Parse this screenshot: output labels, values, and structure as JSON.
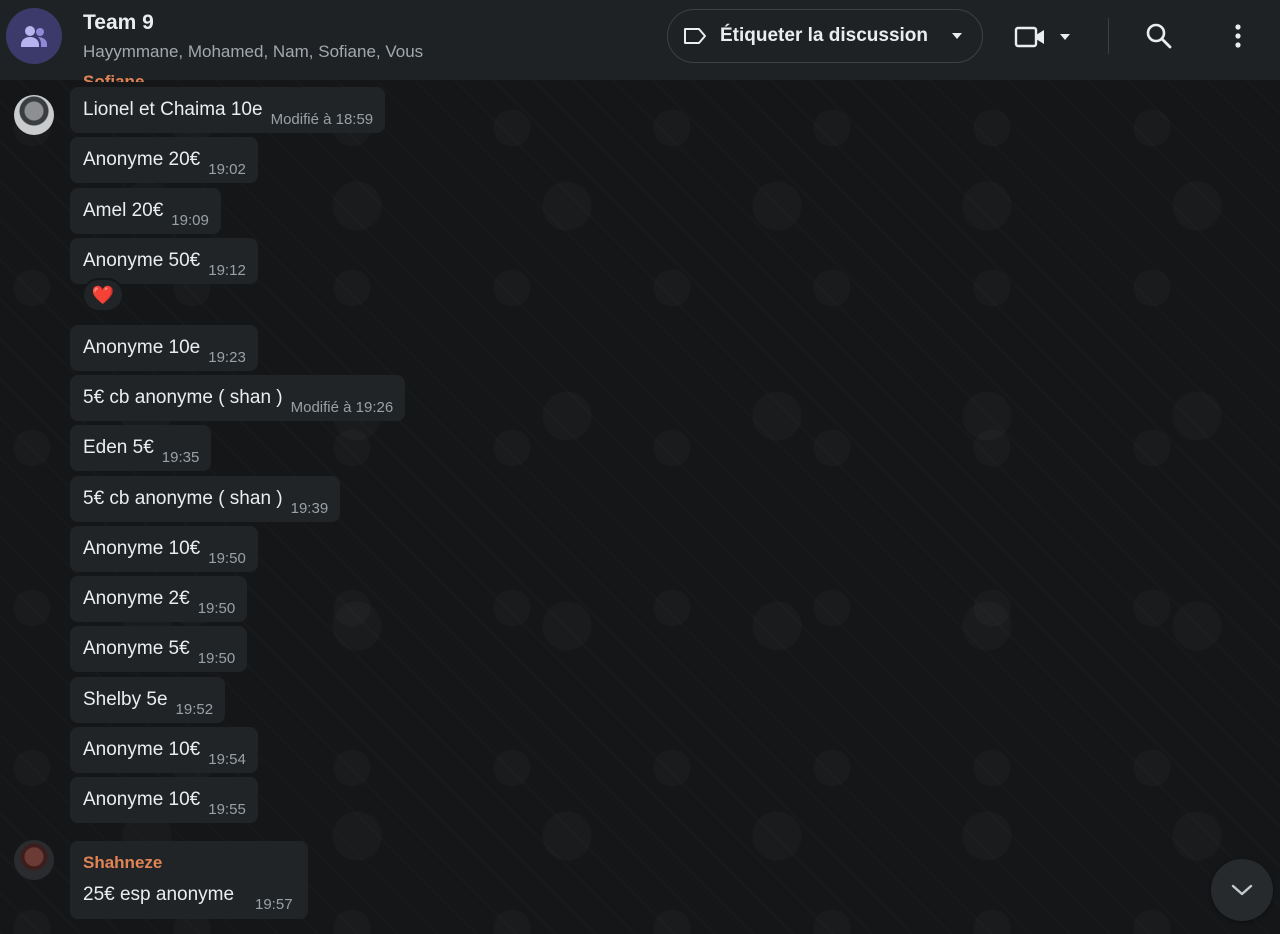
{
  "header": {
    "title": "Team 9",
    "members": "Hayymmane, Mohamed, Nam, Sofiane, Vous",
    "label_button": "Étiqueter la discussion",
    "group_avatar_icon": "group-icon",
    "video_icon": "video-camera-icon",
    "search_icon": "search-icon",
    "menu_icon": "more-vertical-icon"
  },
  "messages": [
    {
      "text": "Lionel et Chaima 10e",
      "time": "Modifié à 18:59"
    },
    {
      "text": "Anonyme 20€",
      "time": "19:02"
    },
    {
      "text": "Amel 20€",
      "time": "19:09"
    },
    {
      "text": "Anonyme 50€",
      "time": "19:12"
    },
    {
      "text": "Anonyme 10e",
      "time": "19:23"
    },
    {
      "text": "5€ cb anonyme ( shan )",
      "time": "Modifié à 19:26"
    },
    {
      "text": "Eden 5€",
      "time": "19:35"
    },
    {
      "text": "5€ cb anonyme ( shan )",
      "time": "19:39"
    },
    {
      "text": "Anonyme 10€",
      "time": "19:50"
    },
    {
      "text": "Anonyme 2€",
      "time": "19:50"
    },
    {
      "text": "Anonyme 5€",
      "time": "19:50"
    },
    {
      "text": "Shelby 5e",
      "time": "19:52"
    },
    {
      "text": "Anonyme 10€",
      "time": "19:54"
    },
    {
      "text": "Anonyme 10€",
      "time": "19:55"
    }
  ],
  "partial_sender": "Sofiane",
  "reaction": "❤️",
  "last_message": {
    "sender": "Shahneze",
    "text": "25€ esp anonyme",
    "time": "19:57"
  },
  "colors": {
    "sender_name": "#e08356",
    "bubble": "#202426",
    "header": "#1f2224"
  }
}
